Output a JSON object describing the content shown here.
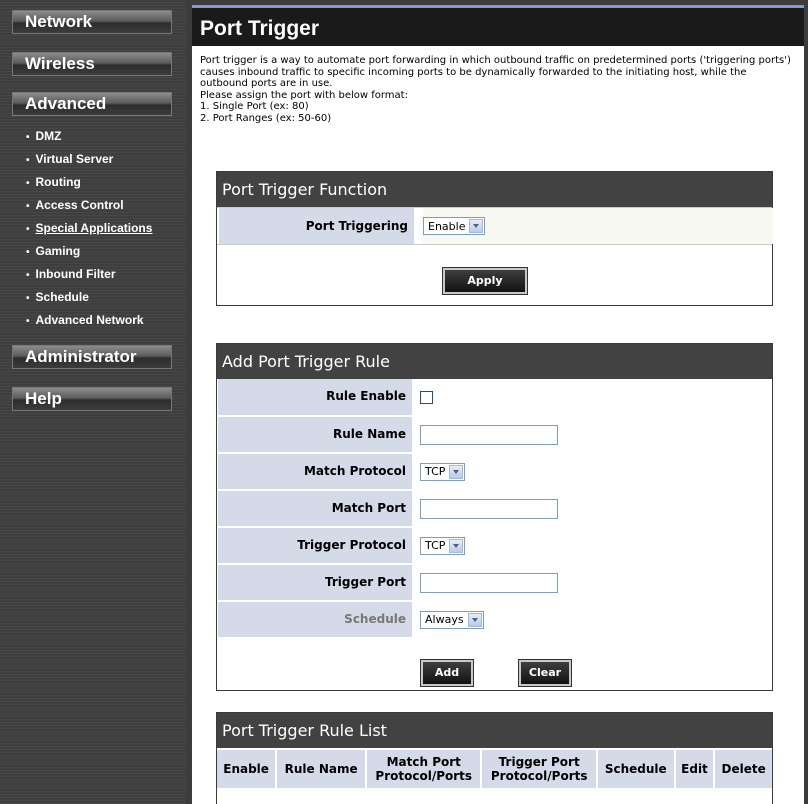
{
  "sidebar": {
    "sections": {
      "network": "Network",
      "wireless": "Wireless",
      "advanced": "Advanced",
      "administrator": "Administrator",
      "help": "Help"
    },
    "advanced_items": [
      {
        "label": "DMZ"
      },
      {
        "label": "Virtual Server"
      },
      {
        "label": "Routing"
      },
      {
        "label": "Access Control"
      },
      {
        "label": "Special Applications"
      },
      {
        "label": "Gaming"
      },
      {
        "label": "Inbound Filter"
      },
      {
        "label": "Schedule"
      },
      {
        "label": "Advanced Network"
      }
    ],
    "active_item": "Special Applications"
  },
  "page": {
    "title": "Port Trigger",
    "intro_lines": [
      "Port trigger is a way to automate port forwarding in which outbound traffic on predetermined ports ('triggering ports') causes inbound traffic to specific incoming ports to be dynamically forwarded to the initiating host, while the outbound ports are in use.",
      "Please assign the port with below format:",
      "1. Single Port (ex: 80)",
      "2. Port Ranges (ex: 50-60)"
    ]
  },
  "function_panel": {
    "title": "Port Trigger Function",
    "port_triggering_label": "Port Triggering",
    "port_triggering_value": "Enable",
    "apply_label": "Apply"
  },
  "add_rule_panel": {
    "title": "Add Port Trigger Rule",
    "rule_enable_label": "Rule Enable",
    "rule_enable_checked": false,
    "rule_name_label": "Rule Name",
    "rule_name_value": "",
    "match_protocol_label": "Match Protocol",
    "match_protocol_value": "TCP",
    "match_port_label": "Match Port",
    "match_port_value": "",
    "trigger_protocol_label": "Trigger Protocol",
    "trigger_protocol_value": "TCP",
    "trigger_port_label": "Trigger Port",
    "trigger_port_value": "",
    "schedule_label": "Schedule",
    "schedule_value": "Always",
    "add_label": "Add",
    "clear_label": "Clear"
  },
  "rule_list_panel": {
    "title": "Port Trigger Rule List",
    "columns": {
      "enable": "Enable",
      "rule_name": "Rule Name",
      "match_port_1": "Match Port",
      "match_port_2": "Protocol/Ports",
      "trigger_port_1": "Trigger Port",
      "trigger_port_2": "Protocol/Ports",
      "schedule": "Schedule",
      "edit": "Edit",
      "delete": "Delete"
    }
  },
  "colors": {
    "accent": "#7d9cd4",
    "label_bg": "#d4dae8",
    "panel_header": "#424242",
    "sidebar_bg": "#3c3c3c"
  }
}
